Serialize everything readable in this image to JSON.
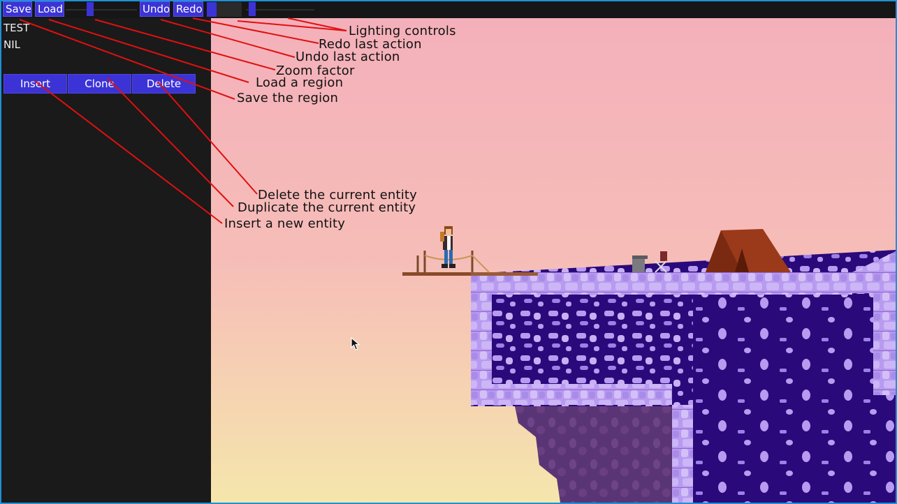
{
  "toolbar": {
    "save_label": "Save",
    "load_label": "Load",
    "undo_label": "Undo",
    "redo_label": "Redo",
    "zoom_slider_level": 0.33,
    "lighting_slider_level": 0.05
  },
  "sidebar": {
    "region_name": "TEST",
    "entity_name": "NIL",
    "insert_label": "Insert",
    "clone_label": "Clone",
    "delete_label": "Delete"
  },
  "annotations": {
    "lighting": "Lighting controls",
    "redo": "Redo last action",
    "undo": "Undo last action",
    "zoom": "Zoom factor",
    "load": "Load a region",
    "save": "Save the region",
    "delete": "Delete the current entity",
    "duplicate": "Duplicate the current entity",
    "insert": "Insert a new entity"
  },
  "colors": {
    "accent": "#3c33d6",
    "sky_top": "#f4b0ba",
    "sky_bottom": "#f5e6ac",
    "rock_dark": "#2a0a7a",
    "rock_light": "#b89af0",
    "annotation_line": "#e01010",
    "frame": "#1e90d6"
  },
  "icons": {
    "cursor": "mouse-pointer-icon"
  }
}
